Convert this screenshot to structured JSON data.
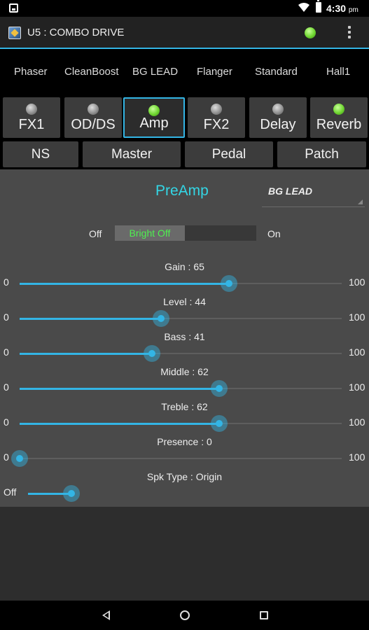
{
  "status_bar": {
    "time": "4:30",
    "ampm": "pm",
    "icons": [
      "notification-icon",
      "wifi-icon",
      "battery-icon"
    ]
  },
  "app": {
    "title": "U5 : COMBO DRIVE",
    "connection_led": "on",
    "accent": "#33b5e5"
  },
  "presets": [
    "Phaser",
    "CleanBoost",
    "BG LEAD",
    "Flanger",
    "Standard",
    "Hall1"
  ],
  "effects": [
    {
      "label": "FX1",
      "led": "off",
      "active": false
    },
    {
      "label": "OD/DS",
      "led": "off",
      "active": false
    },
    {
      "label": "Amp",
      "led": "on",
      "active": true
    },
    {
      "label": "FX2",
      "led": "off",
      "active": false
    },
    {
      "label": "Delay",
      "led": "off",
      "active": false
    },
    {
      "label": "Reverb",
      "led": "on",
      "active": false
    }
  ],
  "sub_buttons": [
    "NS",
    "Master",
    "Pedal",
    "Patch"
  ],
  "panel": {
    "title": "PreAmp",
    "amp_type": "BG LEAD",
    "bright": {
      "off_label": "Off",
      "on_label": "On",
      "value": "Bright Off"
    },
    "sliders": [
      {
        "label": "Gain : 65",
        "min": "0",
        "max": "100",
        "value": 65
      },
      {
        "label": "Level : 44",
        "min": "0",
        "max": "100",
        "value": 44
      },
      {
        "label": "Bass : 41",
        "min": "0",
        "max": "100",
        "value": 41
      },
      {
        "label": "Middle : 62",
        "min": "0",
        "max": "100",
        "value": 62
      },
      {
        "label": "Treble : 62",
        "min": "0",
        "max": "100",
        "value": 62
      },
      {
        "label": "Presence : 0",
        "min": "0",
        "max": "100",
        "value": 0
      }
    ],
    "spk_type": {
      "label": "Spk Type : Origin",
      "min": "Off",
      "value": 0.14
    }
  },
  "nav": [
    "back-icon",
    "home-icon",
    "recents-icon"
  ]
}
